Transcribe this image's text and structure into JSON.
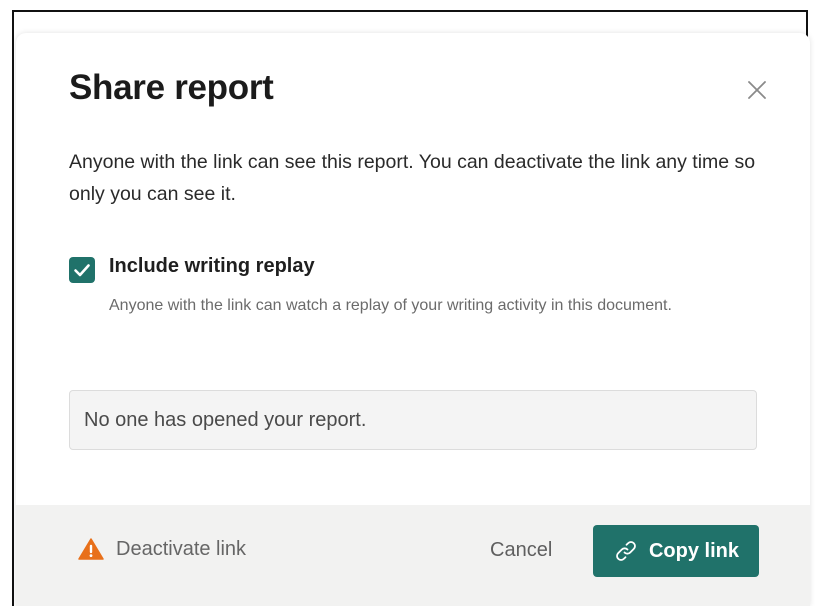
{
  "dialog": {
    "title": "Share report",
    "description": "Anyone with the link can see this report. You can deactivate the link any time so only you can see it.",
    "replay_option": {
      "label": "Include writing replay",
      "checked": true,
      "help": "Anyone with the link can watch a replay of your writing activity in this document."
    },
    "status_text": "No one has opened your report."
  },
  "footer": {
    "deactivate_label": "Deactivate link",
    "cancel_label": "Cancel",
    "copy_label": "Copy link"
  },
  "icons": {
    "close": "close-icon",
    "check": "checkmark-icon",
    "warning": "warning-triangle-icon",
    "link": "link-icon"
  },
  "colors": {
    "accent": "#20726a",
    "warning": "#e8701a",
    "footer_bg": "#f2f2f1"
  }
}
